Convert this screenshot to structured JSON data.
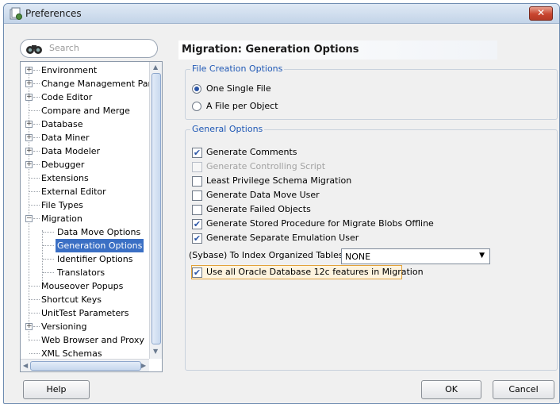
{
  "window": {
    "title": "Preferences",
    "close_label": "✕"
  },
  "search": {
    "placeholder": "Search"
  },
  "tree": {
    "items": [
      {
        "label": "Environment"
      },
      {
        "label": "Change Management Paran"
      },
      {
        "label": "Code Editor"
      },
      {
        "label": "Compare and Merge"
      },
      {
        "label": "Database"
      },
      {
        "label": "Data Miner"
      },
      {
        "label": "Data Modeler"
      },
      {
        "label": "Debugger"
      },
      {
        "label": "Extensions"
      },
      {
        "label": "External Editor"
      },
      {
        "label": "File Types"
      },
      {
        "label": "Migration"
      },
      {
        "label": "Data Move Options"
      },
      {
        "label": "Generation Options"
      },
      {
        "label": "Identifier Options"
      },
      {
        "label": "Translators"
      },
      {
        "label": "Mouseover Popups"
      },
      {
        "label": "Shortcut Keys"
      },
      {
        "label": "UnitTest Parameters"
      },
      {
        "label": "Versioning"
      },
      {
        "label": "Web Browser and Proxy"
      },
      {
        "label": "XML Schemas"
      }
    ]
  },
  "main": {
    "title": "Migration: Generation Options",
    "file_creation": {
      "legend": "File Creation Options",
      "options": [
        {
          "label": "One Single File",
          "selected": true
        },
        {
          "label": "A File per Object",
          "selected": false
        }
      ]
    },
    "general": {
      "legend": "General Options",
      "checkboxes": [
        {
          "label": "Generate Comments",
          "checked": true,
          "enabled": true
        },
        {
          "label": "Generate Controlling Script",
          "checked": false,
          "enabled": false
        },
        {
          "label": "Least Privilege Schema Migration",
          "checked": false,
          "enabled": true
        },
        {
          "label": "Generate Data Move User",
          "checked": false,
          "enabled": true
        },
        {
          "label": "Generate Failed Objects",
          "checked": false,
          "enabled": true
        },
        {
          "label": "Generate Stored Procedure for Migrate Blobs Offline",
          "checked": true,
          "enabled": true
        },
        {
          "label": "Generate Separate Emulation User",
          "checked": true,
          "enabled": true
        }
      ],
      "index_tables": {
        "label": "(Sybase) To Index Organized Tables",
        "value": "NONE"
      },
      "oracle12c": {
        "label": "Use all Oracle Database 12c features in Migration",
        "checked": true
      }
    }
  },
  "footer": {
    "help_label": "Help",
    "ok_label": "OK",
    "cancel_label": "Cancel"
  },
  "glyphs": {
    "check": "✔",
    "plus": "+",
    "minus": "−",
    "dropdown": "▼",
    "up": "▲",
    "down": "▼",
    "left": "◀",
    "right": "▶"
  },
  "colors": {
    "accent": "#3a6fc4",
    "legend_text": "#1f58b5",
    "close_button": "#c8452f"
  }
}
